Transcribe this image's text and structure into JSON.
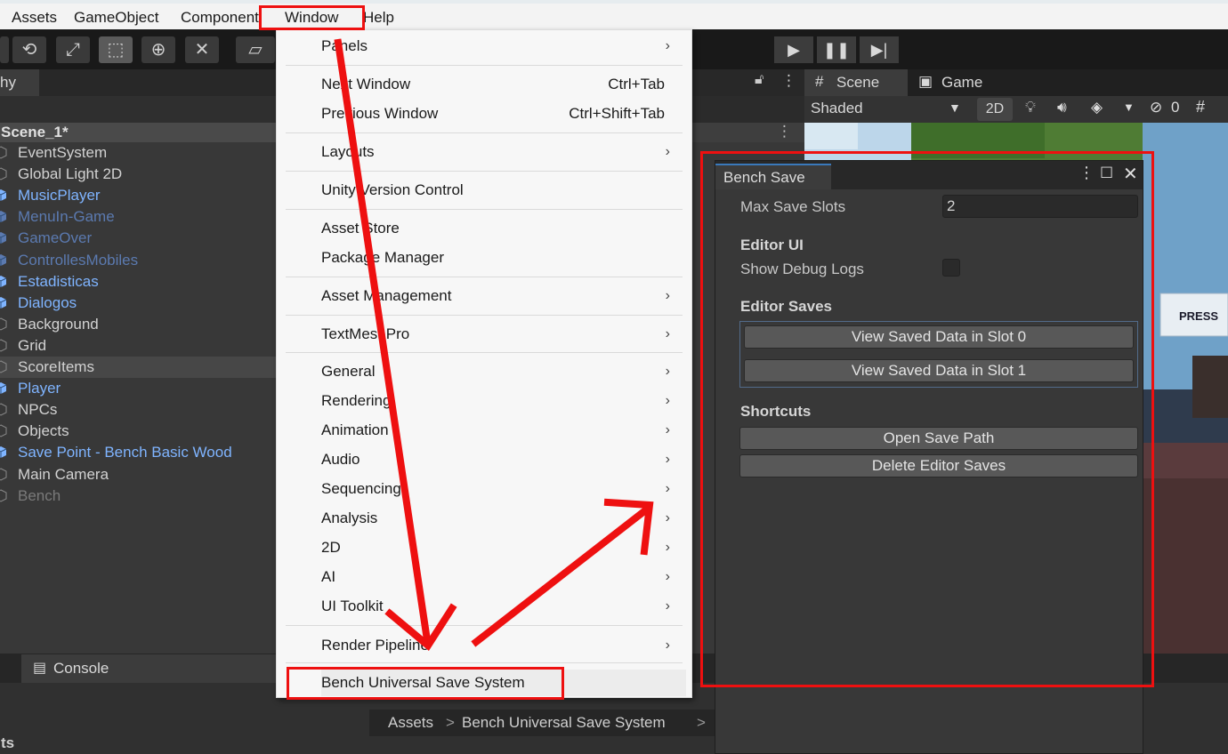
{
  "menubar": {
    "items": [
      "Assets",
      "GameObject",
      "Component",
      "Window",
      "Help"
    ]
  },
  "hierarchy": {
    "tab_label": "hy",
    "scene_name": "Scene_1*",
    "items": [
      {
        "label": "EventSystem",
        "style": "normal"
      },
      {
        "label": "Global Light 2D",
        "style": "normal"
      },
      {
        "label": "MusicPlayer",
        "style": "prefab"
      },
      {
        "label": "MenuIn-Game",
        "style": "prefab-inactive"
      },
      {
        "label": "GameOver",
        "style": "prefab-inactive"
      },
      {
        "label": "ControllesMobiles",
        "style": "prefab-inactive"
      },
      {
        "label": "Estadisticas",
        "style": "prefab"
      },
      {
        "label": "Dialogos",
        "style": "prefab"
      },
      {
        "label": "Background",
        "style": "normal"
      },
      {
        "label": "Grid",
        "style": "normal"
      },
      {
        "label": "ScoreItems",
        "style": "selected"
      },
      {
        "label": "Player",
        "style": "prefab"
      },
      {
        "label": "NPCs",
        "style": "normal"
      },
      {
        "label": "Objects",
        "style": "normal"
      },
      {
        "label": "Save Point - Bench Basic Wood",
        "style": "prefab"
      },
      {
        "label": "Main Camera",
        "style": "normal"
      },
      {
        "label": "Bench",
        "style": "inactive"
      }
    ]
  },
  "window_menu": {
    "items": [
      {
        "label": "Panels",
        "shortcut": "",
        "submenu": true
      },
      {
        "label": "Next Window",
        "shortcut": "Ctrl+Tab",
        "submenu": false
      },
      {
        "label": "Previous Window",
        "shortcut": "Ctrl+Shift+Tab",
        "submenu": false
      },
      {
        "label": "Layouts",
        "shortcut": "",
        "submenu": true
      },
      {
        "label": "Unity Version Control",
        "shortcut": "",
        "submenu": false
      },
      {
        "label": "Asset Store",
        "shortcut": "",
        "submenu": false
      },
      {
        "label": "Package Manager",
        "shortcut": "",
        "submenu": false
      },
      {
        "label": "Asset Management",
        "shortcut": "",
        "submenu": true
      },
      {
        "label": "TextMeshPro",
        "shortcut": "",
        "submenu": true
      },
      {
        "label": "General",
        "shortcut": "",
        "submenu": true
      },
      {
        "label": "Rendering",
        "shortcut": "",
        "submenu": true
      },
      {
        "label": "Animation",
        "shortcut": "",
        "submenu": true
      },
      {
        "label": "Audio",
        "shortcut": "",
        "submenu": true
      },
      {
        "label": "Sequencing",
        "shortcut": "",
        "submenu": true
      },
      {
        "label": "Analysis",
        "shortcut": "",
        "submenu": true
      },
      {
        "label": "2D",
        "shortcut": "",
        "submenu": true
      },
      {
        "label": "AI",
        "shortcut": "",
        "submenu": true
      },
      {
        "label": "UI Toolkit",
        "shortcut": "",
        "submenu": true
      },
      {
        "label": "Render Pipeline",
        "shortcut": "",
        "submenu": true
      },
      {
        "label": "Bench Universal Save System",
        "shortcut": "",
        "submenu": false
      }
    ]
  },
  "scene": {
    "tab_scene": "Scene",
    "tab_game": "Game",
    "shading": "Shaded",
    "toggle_2d": "2D",
    "hidden_count": "0",
    "press_text": "PRESS"
  },
  "console": {
    "tab_label": "Console"
  },
  "project": {
    "breadcrumb": [
      "Assets",
      "Bench Universal Save System"
    ],
    "left_label": "ts"
  },
  "bench_save": {
    "title": "Bench Save",
    "max_slots_label": "Max Save Slots",
    "max_slots_value": "2",
    "editor_ui_header": "Editor UI",
    "debug_label": "Show Debug Logs",
    "debug_checked": false,
    "editor_saves_header": "Editor Saves",
    "slot_buttons": [
      "View Saved Data in Slot 0",
      "View Saved Data in Slot 1"
    ],
    "shortcuts_header": "Shortcuts",
    "open_path": "Open Save Path",
    "delete_saves": "Delete Editor Saves"
  },
  "colors": {
    "highlight": "#ee1010",
    "prefab_text": "#7fb4ff",
    "prefab_inactive_text": "#5b7ab0",
    "menu_bg": "#f7f7f7",
    "editor_bg": "#383838"
  }
}
